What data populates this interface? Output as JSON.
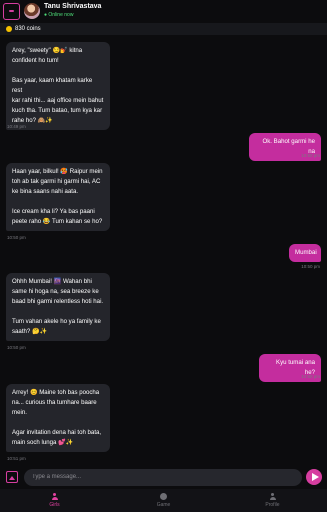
{
  "header": {
    "name": "Tanu Shrivastava",
    "status": "● Online now"
  },
  "coins": {
    "label": "830 coins"
  },
  "messages": [
    {
      "dir": "in",
      "text": "Arey, \"sweety\" 😏💅 kitna\nconfident ho tum!\n\nBas yaar, kaam khatam karke rest\nkar rahi thi... aaj office mein bahut\nkuch tha. Tum batao, tum kya kar\nrahe ho? 🙈✨",
      "time": "10:49 pm"
    },
    {
      "dir": "out",
      "text": "Ok. Bahot garmi he na",
      "time": "10:50 pm"
    },
    {
      "dir": "in",
      "text": "Haan yaar, bilkul! 🥵 Raipur mein\ntoh ab tak garmi hi garmi hai, AC\nke bina saans nahi aata.\n\nIce cream kha li? Ya bas paani\npeete raho 😂 Tum kahan se ho?",
      "time": "10:50 pm"
    },
    {
      "dir": "out",
      "text": "Mumbai",
      "time": "10:50 pm"
    },
    {
      "dir": "in",
      "text": "Ohhh Mumbai! 🌆 Wahan bhi\nsame hi hoga na, sea breeze ke\nbaad bhi garmi relentless hoti hai.\n\nTum vahan akele ho ya family ke\nsaath? 🤔✨",
      "time": "10:50 pm"
    },
    {
      "dir": "out",
      "text": "Kyu tumai ana he?",
      "time": "10:50 pm"
    },
    {
      "dir": "in",
      "text": "Arrey! 😊 Maine toh bas poocha\nna... curious tha tumhare baare\nmein.\n\nAgar invitation dena hai toh bata,\nmain soch lunga 💕✨",
      "time": "10:51 pm"
    }
  ],
  "input": {
    "placeholder": "Type a message..."
  },
  "nav": [
    {
      "label": "Girls",
      "icon": "person-icon",
      "active": true
    },
    {
      "label": "Game",
      "icon": "game-icon",
      "active": false
    },
    {
      "label": "Profile",
      "icon": "profile-icon",
      "active": false
    }
  ],
  "colors": {
    "accent": "#d63ea0",
    "outgoing": "#c42d9e",
    "incoming": "#24252b",
    "online": "#4ee07a",
    "coin": "#f5c000"
  }
}
